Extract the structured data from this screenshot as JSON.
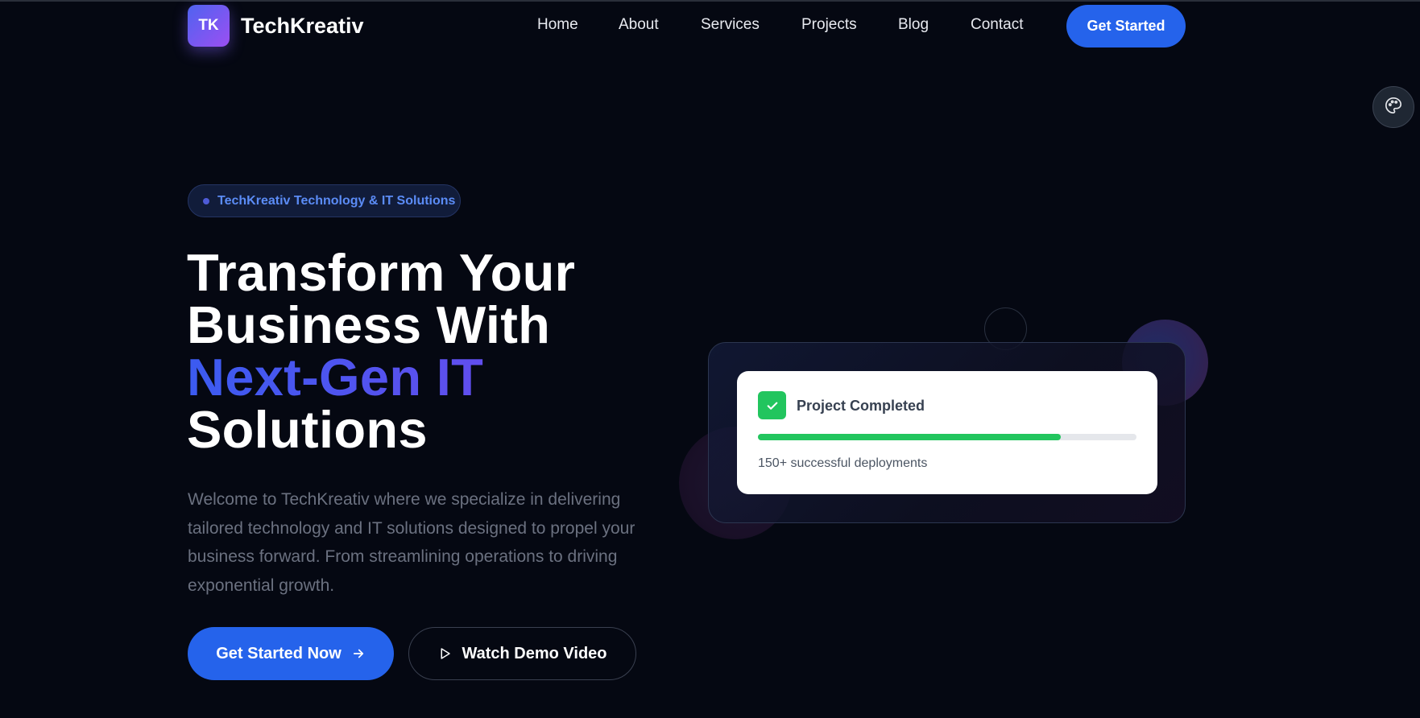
{
  "header": {
    "logo_mark": "TK",
    "brand_name": "TechKreativ",
    "nav": [
      "Home",
      "About",
      "Services",
      "Projects",
      "Blog",
      "Contact"
    ],
    "cta_label": "Get Started"
  },
  "hero": {
    "badge": "TechKreativ Technology & IT Solutions",
    "title_line1": "Transform Your",
    "title_line2": "Business With",
    "title_highlight": "Next-Gen IT",
    "title_line4": "Solutions",
    "description": "Welcome to TechKreativ where we specialize in delivering tailored technology and IT solutions designed to propel your business forward. From streamlining operations to driving exponential growth.",
    "primary_button": "Get Started Now",
    "secondary_button": "Watch Demo Video"
  },
  "status_card": {
    "title": "Project Completed",
    "subtitle": "150+ successful deployments",
    "progress": 0.8
  },
  "icons": {
    "theme": "palette-icon",
    "badge": "dot-icon",
    "check": "check-icon",
    "arrow": "arrow-right-icon",
    "play": "play-icon"
  },
  "colors": {
    "background": "#050812",
    "accent": "#2563eb",
    "gradient_start": "#3b5bf0",
    "gradient_end": "#7b45ec",
    "success": "#22c55e"
  }
}
